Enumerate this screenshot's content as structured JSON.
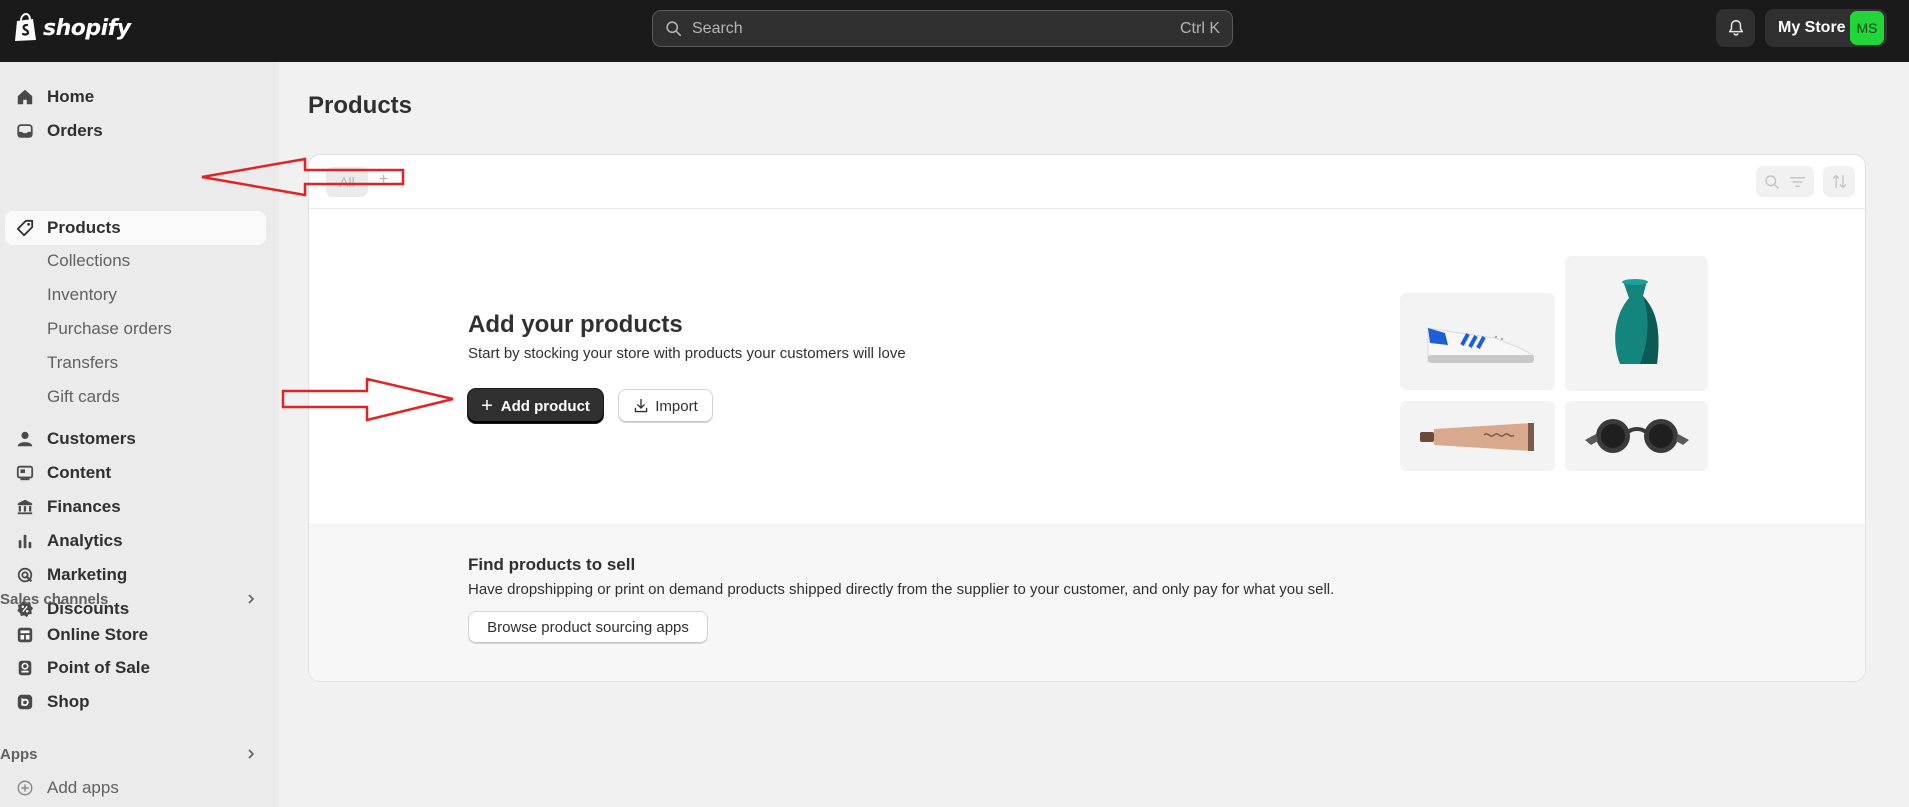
{
  "topbar": {
    "logo_text": "shopify",
    "search_placeholder": "Search",
    "search_shortcut": "Ctrl K",
    "store_name": "My Store",
    "store_initials": "MS"
  },
  "sidebar": {
    "items": [
      {
        "label": "Home",
        "icon": "home-icon"
      },
      {
        "label": "Orders",
        "icon": "inbox-icon"
      },
      {
        "label": "Products",
        "icon": "tag-icon"
      },
      {
        "label": "Collections"
      },
      {
        "label": "Inventory"
      },
      {
        "label": "Purchase orders"
      },
      {
        "label": "Transfers"
      },
      {
        "label": "Gift cards"
      },
      {
        "label": "Customers",
        "icon": "person-icon"
      },
      {
        "label": "Content",
        "icon": "content-icon"
      },
      {
        "label": "Finances",
        "icon": "bank-icon"
      },
      {
        "label": "Analytics",
        "icon": "bar-chart-icon"
      },
      {
        "label": "Marketing",
        "icon": "target-icon"
      },
      {
        "label": "Discounts",
        "icon": "discount-icon"
      }
    ],
    "sales_channels_heading": "Sales channels",
    "sales_channels": [
      {
        "label": "Online Store",
        "icon": "store-icon"
      },
      {
        "label": "Point of Sale",
        "icon": "pos-icon"
      },
      {
        "label": "Shop",
        "icon": "shop-icon"
      }
    ],
    "apps_heading": "Apps",
    "add_apps_label": "Add apps"
  },
  "main": {
    "title": "Products",
    "tab_all": "All",
    "tab_add": "+",
    "empty_state": {
      "title": "Add your products",
      "subtitle": "Start by stocking your store with products your customers will love",
      "primary_button": "Add product",
      "secondary_button": "Import"
    },
    "find_products": {
      "title": "Find products to sell",
      "subtitle": "Have dropshipping or print on demand products shipped directly from the supplier to your customer, and only pay for what you sell.",
      "button": "Browse product sourcing apps"
    }
  },
  "colors": {
    "topbar_bg": "#1a1a1a",
    "avatar_bg": "#22d63a",
    "annotation_arrow": "#e02424",
    "primary_button": "#303030"
  }
}
